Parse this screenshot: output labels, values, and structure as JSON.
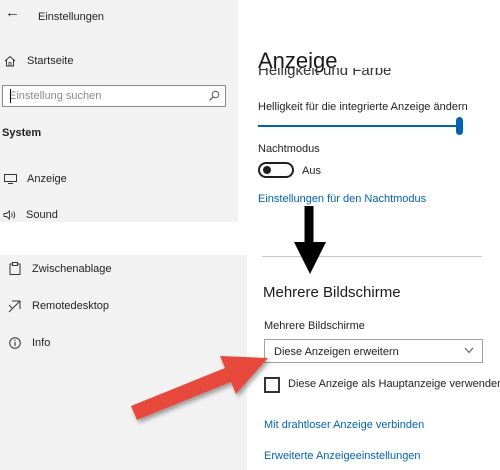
{
  "window": {
    "title": "Einstellungen"
  },
  "sidebar": {
    "home_label": "Startseite",
    "search": {
      "placeholder": "Einstellung suchen"
    },
    "section_label": "System",
    "items": [
      {
        "label": "Anzeige",
        "icon": "monitor-icon"
      },
      {
        "label": "Sound",
        "icon": "speaker-icon"
      },
      {
        "label": "Zwischenablage",
        "icon": "clipboard-icon"
      },
      {
        "label": "Remotedesktop",
        "icon": "remote-desktop-icon"
      },
      {
        "label": "Info",
        "icon": "info-icon"
      }
    ]
  },
  "main": {
    "page_title": "Anzeige",
    "partial_heading": "Helligkeit und Farbe",
    "brightness": {
      "label": "Helligkeit für die integrierte Anzeige ändern",
      "value_percent": 95
    },
    "night_mode": {
      "label": "Nachtmodus",
      "state_label": "Aus",
      "on": false
    },
    "night_mode_link": "Einstellungen für den Nachtmodus",
    "multi_display": {
      "heading": "Mehrere Bildschirme",
      "dropdown_label": "Mehrere Bildschirme",
      "selected_option": "Diese Anzeigen erweitern",
      "primary_checkbox_label": "Diese Anzeige als Hauptanzeige verwenden",
      "primary_checked": false
    },
    "wireless_link": "Mit drahtloser Anzeige verbinden",
    "advanced_link": "Erweiterte Anzeigeeinstellungen"
  },
  "colors": {
    "accent": "#0063b1",
    "sidebar_bg": "#f2f2f2",
    "annotation_red": "#e8493c",
    "annotation_black": "#000000"
  }
}
